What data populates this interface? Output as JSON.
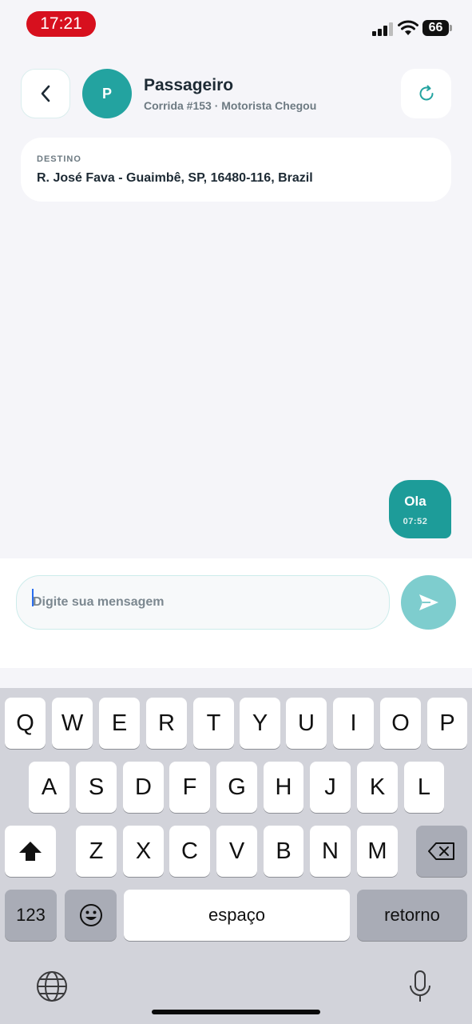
{
  "status_bar": {
    "time": "17:21",
    "battery": "66",
    "icons": [
      "signal-icon",
      "wifi-icon",
      "battery-icon"
    ],
    "time_pill_color": "#d7101e"
  },
  "header": {
    "avatar_initial": "P",
    "title": "Passageiro",
    "subtitle": "Corrida #153 · Motorista Chegou",
    "back_icon": "chevron-left-icon",
    "refresh_icon": "refresh-icon"
  },
  "destination": {
    "label": "DESTINO",
    "value": "R. José Fava - Guaimbê, SP, 16480-116, Brazil"
  },
  "messages": [
    {
      "text": "Ola",
      "time": "07:52",
      "sent": true
    }
  ],
  "composer": {
    "placeholder": "Digite sua mensagem",
    "value": "",
    "send_icon": "send-icon"
  },
  "keyboard": {
    "row1": [
      "Q",
      "W",
      "E",
      "R",
      "T",
      "Y",
      "U",
      "I",
      "O",
      "P"
    ],
    "row2": [
      "A",
      "S",
      "D",
      "F",
      "G",
      "H",
      "J",
      "K",
      "L"
    ],
    "row3": [
      "Z",
      "X",
      "C",
      "V",
      "B",
      "N",
      "M"
    ],
    "numbers_key": "123",
    "space_key": "espaço",
    "return_key": "retorno",
    "shift_icon": "shift-icon",
    "backspace_icon": "backspace-icon",
    "emoji_icon": "emoji-icon",
    "globe_icon": "globe-icon",
    "mic_icon": "microphone-icon"
  },
  "colors": {
    "accent": "#1d9c99",
    "send_button": "#7ecdce",
    "background": "#f5f5f9"
  }
}
